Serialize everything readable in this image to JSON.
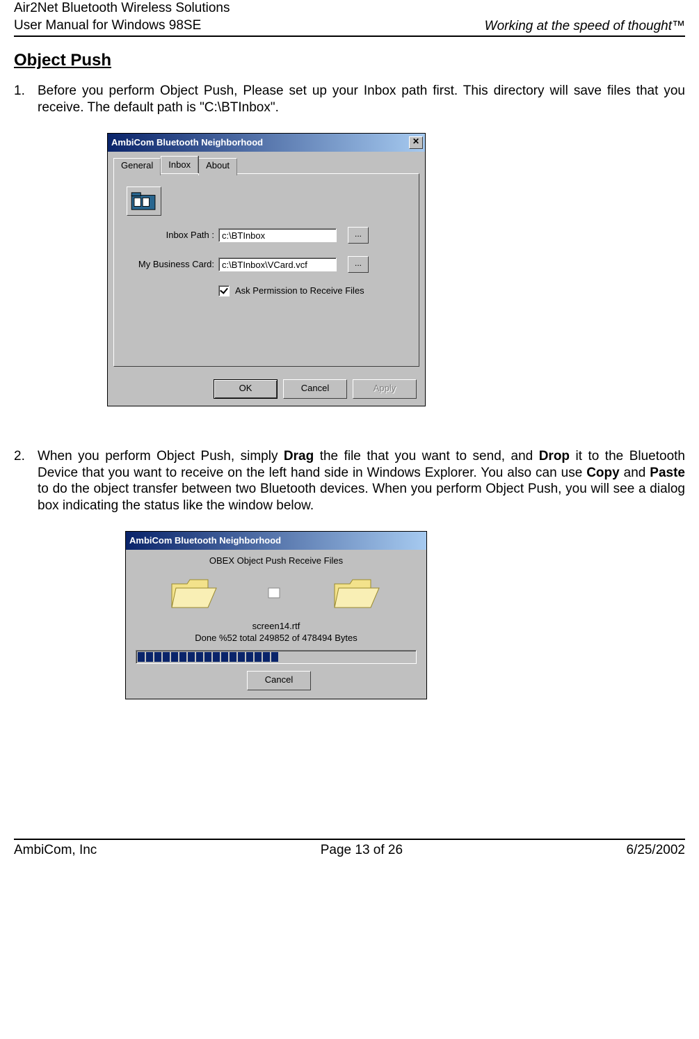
{
  "header": {
    "line1": "Air2Net Bluetooth Wireless Solutions",
    "line2": "User Manual for Windows 98SE",
    "tagline": "Working at the speed of thought™"
  },
  "section_title": "Object Push",
  "para1": {
    "num": "1.",
    "text_a": "Before you perform Object Push, Please set up your Inbox path first. This directory will save files that you receive. The default path is \"C:\\BTInbox\"."
  },
  "dialog1": {
    "title": "AmbiCom Bluetooth Neighborhood",
    "tabs": {
      "general": "General",
      "inbox": "Inbox",
      "about": "About"
    },
    "inbox_label": "Inbox Path :",
    "inbox_value": "c:\\BTInbox",
    "card_label": "My Business Card:",
    "card_value": "c:\\BTInbox\\VCard.vcf",
    "browse": "...",
    "check_label": "Ask Permission to Receive Files",
    "ok": "OK",
    "cancel": "Cancel",
    "apply": "Apply"
  },
  "para2": {
    "num": "2.",
    "t1": "When you perform Object Push, simply ",
    "b1": "Drag",
    "t2": " the file that you want to send, and ",
    "b2": "Drop",
    "t3": " it to the Bluetooth Device that you want to receive on the left hand side in Windows Explorer. You also can use ",
    "b3": "Copy",
    "t4": " and ",
    "b4": "Paste",
    "t5": " to do the object transfer between two Bluetooth devices. When you perform Object Push, you will see a dialog box indicating the status like the window below."
  },
  "dialog2": {
    "title": "AmbiCom Bluetooth Neighborhood",
    "subtitle": "OBEX Object Push Receive Files",
    "filename": "screen14.rtf",
    "status": "Done %52 total 249852 of 478494 Bytes",
    "cancel": "Cancel"
  },
  "footer": {
    "left": "AmbiCom, Inc",
    "center": "Page 13 of 26",
    "right": "6/25/2002"
  }
}
